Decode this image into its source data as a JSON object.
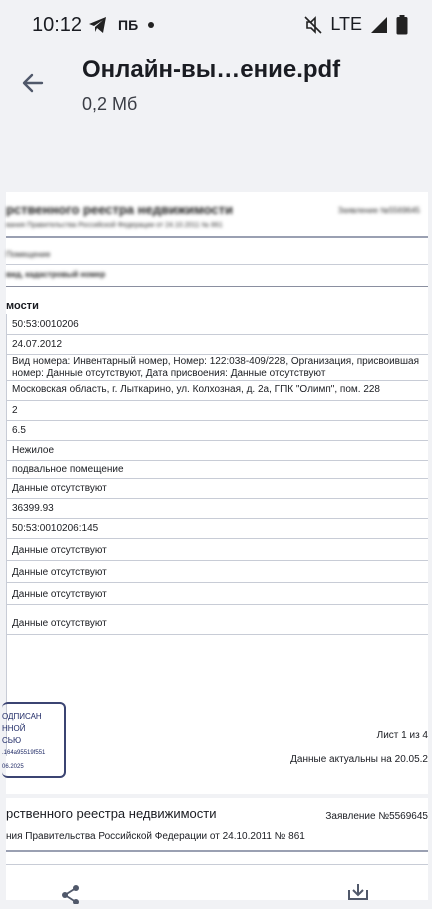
{
  "status_bar": {
    "time": "10:12",
    "left_icons": [
      "telegram-icon",
      "pb-icon",
      "dot-icon"
    ],
    "pb_label": "ПБ",
    "network": "LTE",
    "right_icons": [
      "muted-icon",
      "signal-icon",
      "battery-icon"
    ]
  },
  "top_bar": {
    "title": "Онлайн-вы…ение.pdf",
    "subtitle": "0,2 Мб",
    "back_icon": "arrow-left-icon"
  },
  "page1": {
    "header_blur": "рственного реестра недвижимости",
    "header_right_blur": "Заявление №5569645",
    "header_sub_blur": "вания Правительства Российской Федерации от 24.10.2011 № 861",
    "blur_row1": "Помещение",
    "blur_row2": "вид, кадастровый номер",
    "section_label": "мости",
    "rows": [
      "50:53:0010206",
      "24.07.2012",
      "Вид номера: Инвентарный номер, Номер: 122:038-409/228, Организация, присвоившая номер: Данные отсутствуют, Дата присвоения: Данные отсутствуют",
      "Московская область, г. Лыткарино, ул. Колхозная, д. 2а, ГПК \"Олимп\", пом. 228",
      "2",
      "6.5",
      "Нежилое",
      "подвальное помещение",
      "Данные отсутствуют",
      "36399.93",
      "50:53:0010206:145",
      "Данные отсутствуют",
      "Данные отсутствуют",
      "Данные отсутствуют",
      "Данные отсутствуют"
    ],
    "stamp": {
      "line1": "ОДПИСАН",
      "line2": "ННОЙ",
      "line3": "СЬЮ",
      "line4": ".164a95519f551",
      "line5": "06.2025"
    },
    "sheet": "Лист 1 из 4",
    "actual": "Данные актуальны на 20.05.2"
  },
  "page2": {
    "title": "рственного реестра недвижимости",
    "right": "Заявление №5569645",
    "sub": "ния Правительства Российской Федерации от 24.10.2011 № 861"
  },
  "bottom_bar": {
    "icons": [
      "share-icon",
      "download-icon"
    ]
  },
  "colors": {
    "background": "#f1f2f5",
    "page": "#ffffff",
    "stamp": "#3b4472",
    "rule": "#c8ccd6"
  }
}
